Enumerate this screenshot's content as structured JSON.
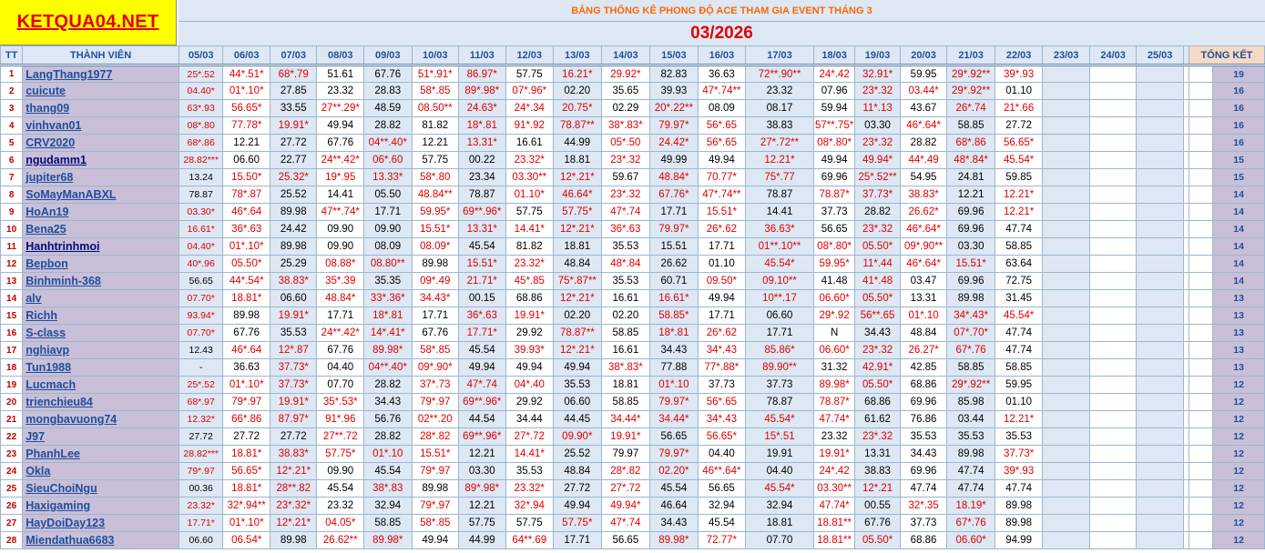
{
  "logo": "KETQUA04.NET",
  "title": "BẢNG THỐNG KÊ PHONG ĐỘ ACE THAM GIA EVENT THÁNG 3",
  "month": "03/2026",
  "headers": {
    "tt": "TT",
    "member": "THÀNH VIÊN",
    "dates": [
      "05/03",
      "06/03",
      "07/03",
      "08/03",
      "09/03",
      "10/03",
      "11/03",
      "12/03",
      "13/03",
      "14/03",
      "15/03",
      "16/03",
      "17/03",
      "18/03",
      "19/03",
      "20/03",
      "21/03",
      "22/03",
      "23/03",
      "24/03",
      "25/03"
    ],
    "total": "TỔNG KẾT"
  },
  "rows": [
    {
      "tt": "1",
      "name": "LangThang1977",
      "vals": [
        "25*.52",
        "44*.51*",
        "68*.79",
        "51.61",
        "67.76",
        "51*.91*",
        "86.97*",
        "57.75",
        "16.21*",
        "29.92*",
        "82.83",
        "36.63",
        "72**.90**",
        "24*.42",
        "32.91*",
        "59.95",
        "29*.92**",
        "39*.93"
      ],
      "total": "19"
    },
    {
      "tt": "2",
      "name": "cuicute",
      "vals": [
        "04.40*",
        "01*.10*",
        "27.85",
        "23.32",
        "28.83",
        "58*.85",
        "89*.98*",
        "07*.96*",
        "02.20",
        "35.65",
        "39.93",
        "47*.74**",
        "23.32",
        "07.96",
        "23*.32",
        "03.44*",
        "29*.92**",
        "01.10"
      ],
      "total": "16"
    },
    {
      "tt": "3",
      "name": "thang09",
      "vals": [
        "63*.93",
        "56.65*",
        "33.55",
        "27**.29*",
        "48.59",
        "08.50**",
        "24.63*",
        "24*.34",
        "20.75*",
        "02.29",
        "20*.22**",
        "08.09",
        "08.17",
        "59.94",
        "11*.13",
        "43.67",
        "26*.74",
        "21*.66"
      ],
      "total": "16"
    },
    {
      "tt": "4",
      "name": "vinhvan01",
      "vals": [
        "08*.80",
        "77.78*",
        "19.91*",
        "49.94",
        "28.82",
        "81.82",
        "18*.81",
        "91*.92",
        "78.87**",
        "38*.83*",
        "79.97*",
        "56*.65",
        "38.83",
        "57**.75*",
        "03.30",
        "46*.64*",
        "58.85",
        "27.72"
      ],
      "total": "16"
    },
    {
      "tt": "5",
      "name": "CRV2020",
      "vals": [
        "68*.86",
        "12.21",
        "27.72",
        "67.76",
        "04**.40*",
        "12.21",
        "13.31*",
        "16.61",
        "44.99",
        "05*.50",
        "24.42*",
        "56*.65",
        "27*.72**",
        "08*.80*",
        "23*.32",
        "28.82",
        "68*.86",
        "56.65*"
      ],
      "total": "16"
    },
    {
      "tt": "6",
      "name": "ngudamm1",
      "vals": [
        "28.82***",
        "06.60",
        "22.77",
        "24**.42*",
        "06*.60",
        "57.75",
        "00.22",
        "23.32*",
        "18.81",
        "23*.32",
        "49.99",
        "49.94",
        "12.21*",
        "49.94",
        "49.94*",
        "44*.49",
        "48*.84*",
        "45.54*"
      ],
      "total": "15"
    },
    {
      "tt": "7",
      "name": "jupiter68",
      "vals": [
        "13.24",
        "15.50*",
        "25.32*",
        "19*.95",
        "13.33*",
        "58*.80",
        "23.34",
        "03.30**",
        "12*.21*",
        "59.67",
        "48.84*",
        "70.77*",
        "75*.77",
        "69.96",
        "25*.52**",
        "54.95",
        "24.81",
        "59.85"
      ],
      "total": "15"
    },
    {
      "tt": "8",
      "name": "SoMayManABXL",
      "vals": [
        "78.87",
        "78*.87",
        "25.52",
        "14.41",
        "05.50",
        "48.84**",
        "78.87",
        "01.10*",
        "46.64*",
        "23*.32",
        "67.76*",
        "47*.74**",
        "78.87",
        "78.87*",
        "37.73*",
        "38.83*",
        "12.21",
        "12.21*"
      ],
      "total": "14"
    },
    {
      "tt": "9",
      "name": "HoAn19",
      "vals": [
        "03.30*",
        "46*.64",
        "89.98",
        "47**.74*",
        "17.71",
        "59.95*",
        "69**.96*",
        "57.75",
        "57.75*",
        "47*.74",
        "17.71",
        "15.51*",
        "14.41",
        "37.73",
        "28.82",
        "26.62*",
        "69.96",
        "12.21*"
      ],
      "total": "14"
    },
    {
      "tt": "10",
      "name": "Bena25",
      "vals": [
        "16.61*",
        "36*.63",
        "24.42",
        "09.90",
        "09.90",
        "15.51*",
        "13.31*",
        "14.41*",
        "12*.21*",
        "36*.63",
        "79.97*",
        "26*.62",
        "36.63*",
        "56.65",
        "23*.32",
        "46*.64*",
        "69.96",
        "47.74"
      ],
      "total": "14"
    },
    {
      "tt": "11",
      "name": "Hanhtrinhmoi",
      "vals": [
        "04.40*",
        "01*.10*",
        "89.98",
        "09.90",
        "08.09",
        "08.09*",
        "45.54",
        "81.82",
        "18.81",
        "35.53",
        "15.51",
        "17.71",
        "01**.10**",
        "08*.80*",
        "05.50*",
        "09*.90**",
        "03.30",
        "58.85"
      ],
      "total": "14"
    },
    {
      "tt": "12",
      "name": "Bepbon",
      "vals": [
        "40*.96",
        "05.50*",
        "25.29",
        "08.88*",
        "08.80**",
        "89.98",
        "15.51*",
        "23.32*",
        "48.84",
        "48*.84",
        "26.62",
        "01.10",
        "45.54*",
        "59.95*",
        "11*.44",
        "46*.64*",
        "15.51*",
        "63.64"
      ],
      "total": "14"
    },
    {
      "tt": "13",
      "name": "Binhminh-368",
      "vals": [
        "56.65",
        "44*.54*",
        "38.83*",
        "35*.39",
        "35.35",
        "09*.49",
        "21.71*",
        "45*.85",
        "75*.87**",
        "35.53",
        "60.71",
        "09.50*",
        "09.10**",
        "41.48",
        "41*.48",
        "03.47",
        "69.96",
        "72.75"
      ],
      "total": "14"
    },
    {
      "tt": "14",
      "name": "alv",
      "vals": [
        "07.70*",
        "18.81*",
        "06.60",
        "48.84*",
        "33*.36*",
        "34.43*",
        "00.15",
        "68.86",
        "12*.21*",
        "16.61",
        "16.61*",
        "49.94",
        "10**.17",
        "06.60*",
        "05.50*",
        "13.31",
        "89.98",
        "31.45"
      ],
      "total": "13"
    },
    {
      "tt": "15",
      "name": "Richh",
      "vals": [
        "93.94*",
        "89.98",
        "19.91*",
        "17.71",
        "18*.81",
        "17.71",
        "36*.63",
        "19.91*",
        "02.20",
        "02.20",
        "58.85*",
        "17.71",
        "06.60",
        "29*.92",
        "56**.65",
        "01*.10",
        "34*.43*",
        "45.54*"
      ],
      "total": "13"
    },
    {
      "tt": "16",
      "name": "S-class",
      "vals": [
        "07.70*",
        "67.76",
        "35.53",
        "24**.42*",
        "14*.41*",
        "67.76",
        "17.71*",
        "29.92",
        "78.87**",
        "58.85",
        "18*.81",
        "26*.62",
        "17.71",
        "N",
        "34.43",
        "48.84",
        "07*.70*",
        "47.74"
      ],
      "total": "13"
    },
    {
      "tt": "17",
      "name": "nghiavp",
      "vals": [
        "12.43",
        "46*.64",
        "12*.87",
        "67.76",
        "89.98*",
        "58*.85",
        "45.54",
        "39.93*",
        "12*.21*",
        "16.61",
        "34.43",
        "34*.43",
        "85.86*",
        "06.60*",
        "23*.32",
        "26.27*",
        "67*.76",
        "47.74"
      ],
      "total": "13"
    },
    {
      "tt": "18",
      "name": "Tun1988",
      "vals": [
        "-",
        "36.63",
        "37.73*",
        "04.40",
        "04**.40*",
        "09*.90*",
        "49.94",
        "49.94",
        "49.94",
        "38*.83*",
        "77.88",
        "77*.88*",
        "89.90**",
        "31.32",
        "42.91*",
        "42.85",
        "58.85",
        "58.85"
      ],
      "total": "13"
    },
    {
      "tt": "19",
      "name": "Lucmach",
      "vals": [
        "25*.52",
        "01*.10*",
        "37.73*",
        "07.70",
        "28.82",
        "37*.73",
        "47*.74",
        "04*.40",
        "35.53",
        "18.81",
        "01*.10",
        "37.73",
        "37.73",
        "89.98*",
        "05.50*",
        "68.86",
        "29*.92**",
        "59.95"
      ],
      "total": "12"
    },
    {
      "tt": "20",
      "name": "trienchieu84",
      "vals": [
        "68*.97",
        "79*.97",
        "19.91*",
        "35*.53*",
        "34.43",
        "79*.97",
        "69**.96*",
        "29.92",
        "06.60",
        "58.85",
        "79.97*",
        "56*.65",
        "78.87",
        "78.87*",
        "68.86",
        "69.96",
        "85.98",
        "01.10"
      ],
      "total": "12"
    },
    {
      "tt": "21",
      "name": "mongbavuong74",
      "vals": [
        "12.32*",
        "66*.86",
        "87.97*",
        "91*.96",
        "56.76",
        "02**.20",
        "44.54",
        "34.44",
        "44.45",
        "34.44*",
        "34.44*",
        "34*.43",
        "45.54*",
        "47.74*",
        "61.62",
        "76.86",
        "03.44",
        "12.21*"
      ],
      "total": "12"
    },
    {
      "tt": "22",
      "name": "J97",
      "vals": [
        "27.72",
        "27.72",
        "27.72",
        "27**.72",
        "28.82",
        "28*.82",
        "69**.96*",
        "27*.72",
        "09.90*",
        "19.91*",
        "56.65",
        "56.65*",
        "15*.51",
        "23.32",
        "23*.32",
        "35.53",
        "35.53",
        "35.53"
      ],
      "total": "12"
    },
    {
      "tt": "23",
      "name": "PhanhLee",
      "vals": [
        "28.82***",
        "18.81*",
        "38.83*",
        "57.75*",
        "01*.10",
        "15.51*",
        "12.21",
        "14.41*",
        "25.52",
        "79.97",
        "79.97*",
        "04.40",
        "19.91",
        "19.91*",
        "13.31",
        "34.43",
        "89.98",
        "37.73*"
      ],
      "total": "12"
    },
    {
      "tt": "24",
      "name": "Okla",
      "vals": [
        "79*.97",
        "56.65*",
        "12*.21*",
        "09.90",
        "45.54",
        "79*.97",
        "03.30",
        "35.53",
        "48.84",
        "28*.82",
        "02.20*",
        "46**.64*",
        "04.40",
        "24*.42",
        "38.83",
        "69.96",
        "47.74",
        "39*.93"
      ],
      "total": "12"
    },
    {
      "tt": "25",
      "name": "SieuChoiNgu",
      "vals": [
        "00.36",
        "18.81*",
        "28**.82",
        "45.54",
        "38*.83",
        "89.98",
        "89*.98*",
        "23.32*",
        "27.72",
        "27*.72",
        "45.54",
        "56.65",
        "45.54*",
        "03.30**",
        "12*.21",
        "47.74",
        "47.74",
        "47.74"
      ],
      "total": "12"
    },
    {
      "tt": "26",
      "name": "Haxigaming",
      "vals": [
        "23.32*",
        "32*.94**",
        "23*.32*",
        "23.32",
        "32.94",
        "79*.97",
        "12.21",
        "32*.94",
        "49.94",
        "49.94*",
        "46.64",
        "32.94",
        "32.94",
        "47.74*",
        "00.55",
        "32*.35",
        "18.19*",
        "89.98"
      ],
      "total": "12"
    },
    {
      "tt": "27",
      "name": "HayDoiDay123",
      "vals": [
        "17.71*",
        "01*.10*",
        "12*.21*",
        "04.05*",
        "58.85",
        "58*.85",
        "57.75",
        "57.75",
        "57.75*",
        "47*.74",
        "34.43",
        "45.54",
        "18.81",
        "18.81**",
        "67.76",
        "37.73",
        "67*.76",
        "89.98"
      ],
      "total": "12"
    },
    {
      "tt": "28",
      "name": "Miendathua6683",
      "vals": [
        "06.60",
        "06.54*",
        "89.98",
        "26.62**",
        "89.98*",
        "49.94",
        "44.99",
        "64**.69",
        "17.71",
        "56.65",
        "89.98*",
        "72.77*",
        "07.70",
        "18.81**",
        "05.50*",
        "68.86",
        "06.60*",
        "94.99"
      ],
      "total": "12"
    }
  ],
  "colors": {
    "red": "#e00000",
    "blue": "#1f4e9c",
    "lightblue": "#dde8f4",
    "purple": "#c9bfd8",
    "yellow": "#ffff00"
  }
}
